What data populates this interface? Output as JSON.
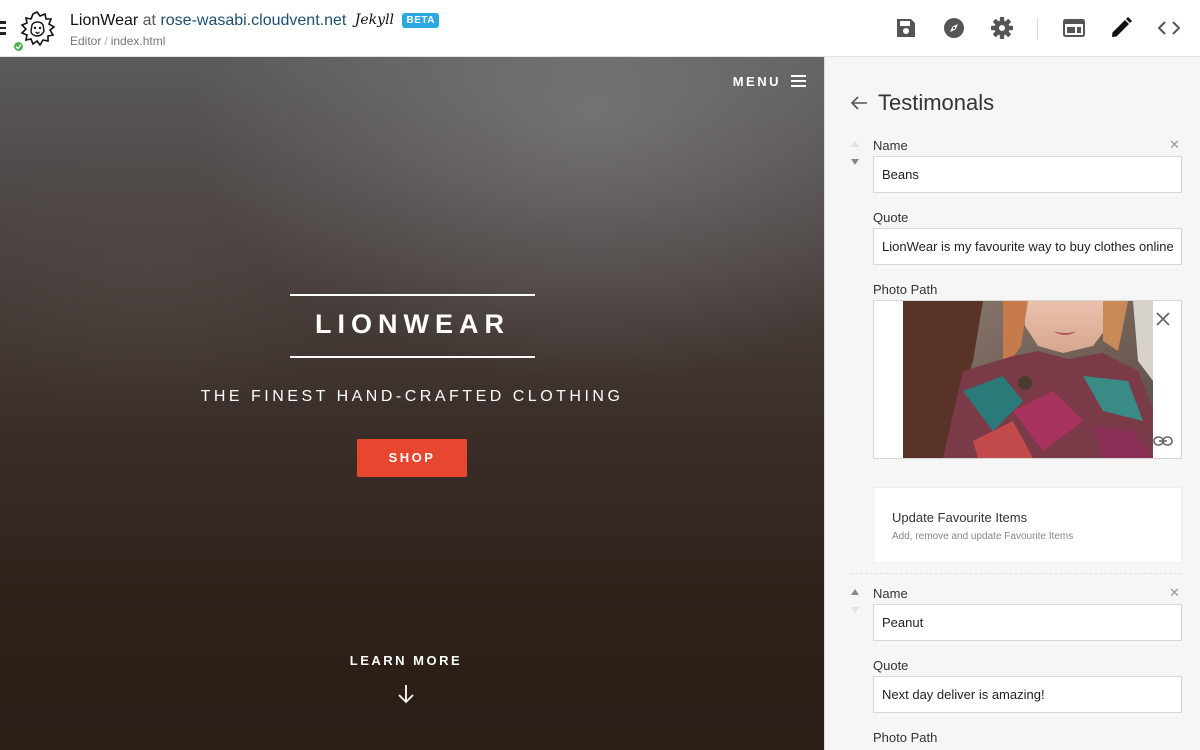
{
  "topbar": {
    "site_name": "LionWear",
    "at": "at",
    "host": "rose-wasabi.cloudvent.net",
    "ssg_logo": "Jekyll",
    "beta_badge": "BETA",
    "breadcrumb": [
      "Editor",
      "index.html"
    ],
    "icons": [
      "save-icon",
      "compass-icon",
      "settings-gear-icon",
      "layout-icon",
      "edit-pencil-icon",
      "source-code-icon"
    ]
  },
  "preview": {
    "menu_label": "MENU",
    "hero_title": "LIONWEAR",
    "hero_subtitle": "THE FINEST HAND-CRAFTED CLOTHING",
    "shop_button": "SHOP",
    "learn_more": "LEARN MORE",
    "accent_color": "#e9462f"
  },
  "panel": {
    "title": "Testimonals",
    "items": [
      {
        "name_label": "Name",
        "name_value": "Beans",
        "quote_label": "Quote",
        "quote_value": "LionWear is my favourite way to buy clothes online",
        "photo_label": "Photo Path",
        "favourites_title": "Update Favourite Items",
        "favourites_desc": "Add, remove and update Favourite Items"
      },
      {
        "name_label": "Name",
        "name_value": "Peanut",
        "quote_label": "Quote",
        "quote_value": "Next day deliver is amazing!",
        "photo_label": "Photo Path"
      }
    ]
  }
}
